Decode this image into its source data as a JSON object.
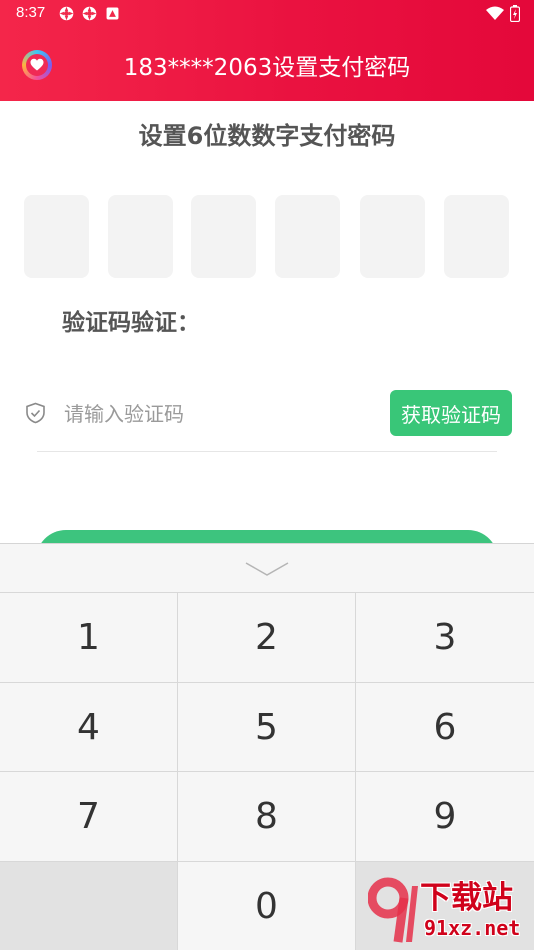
{
  "status_bar": {
    "time": "8:37"
  },
  "header": {
    "title": "183****2063设置支付密码"
  },
  "page": {
    "heading": "设置6位数数字支付密码",
    "pin_boxes": [
      "",
      "",
      "",
      "",
      "",
      ""
    ],
    "verify_label": "验证码验证：",
    "code_input": {
      "value": "",
      "placeholder": "请输入验证码"
    },
    "get_code_label": "获取验证码"
  },
  "keyboard": {
    "keys": [
      "1",
      "2",
      "3",
      "4",
      "5",
      "6",
      "7",
      "8",
      "9",
      "",
      "0",
      ""
    ]
  },
  "watermark": {
    "cn": "下载站",
    "en": "91xz.net"
  },
  "colors": {
    "header_start": "#f4264a",
    "header_end": "#e4083a",
    "accent_green": "#39c678",
    "heading_gray": "#555555"
  },
  "icons": {
    "status_left": [
      "settings-icon",
      "settings-icon",
      "app-icon"
    ],
    "status_right": [
      "wifi-icon",
      "battery-icon"
    ],
    "header_left": "heart-logo-icon",
    "input_left": "shield-check-icon",
    "keyboard_collapse": "chevron-down-icon"
  }
}
